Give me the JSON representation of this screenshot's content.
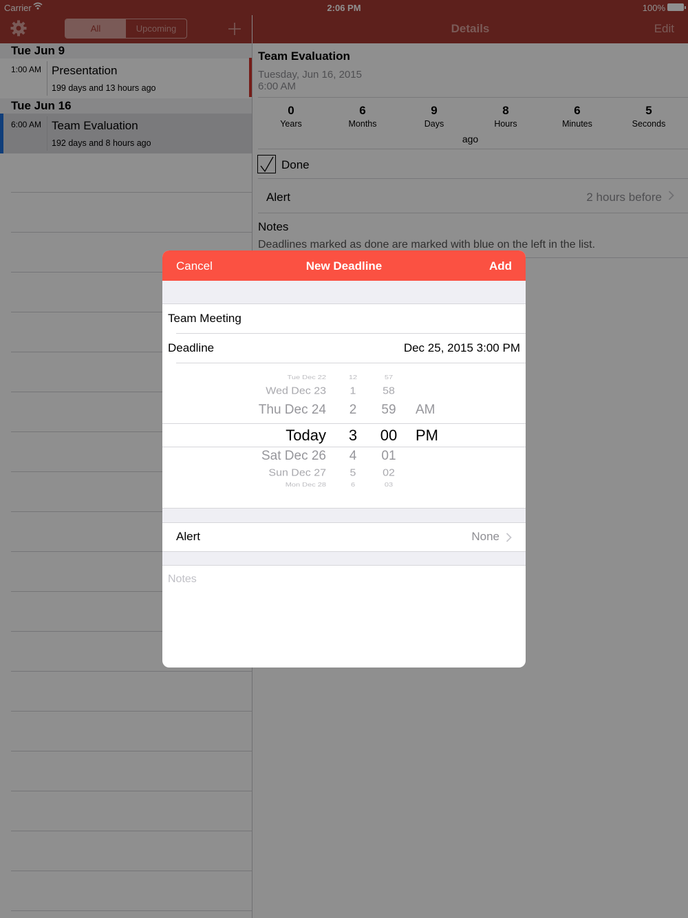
{
  "status_bar": {
    "carrier": "Carrier",
    "time": "2:06 PM",
    "battery": "100%"
  },
  "master_nav": {
    "segments": [
      "All",
      "Upcoming"
    ],
    "selected_segment": "All"
  },
  "detail_nav": {
    "title": "Details",
    "edit_label": "Edit"
  },
  "list": {
    "sections": [
      {
        "header": "Tue  Jun 9",
        "items": [
          {
            "time": "1:00 AM",
            "title": "Presentation",
            "relative": "199 days and 13 hours ago"
          }
        ]
      },
      {
        "header": "Tue  Jun 16",
        "items": [
          {
            "time": "6:00 AM",
            "title": "Team Evaluation",
            "relative": "192 days and 8 hours ago"
          }
        ]
      }
    ],
    "done_indicator_color": "#1e6fd9"
  },
  "details": {
    "title": "Team Evaluation",
    "date": "Tuesday, Jun 16, 2015",
    "time": "6:00 AM",
    "counters": [
      {
        "num": "0",
        "unit": "Years"
      },
      {
        "num": "6",
        "unit": "Months"
      },
      {
        "num": "9",
        "unit": "Days"
      },
      {
        "num": "8",
        "unit": "Hours"
      },
      {
        "num": "6",
        "unit": "Minutes"
      },
      {
        "num": "5",
        "unit": "Seconds"
      }
    ],
    "ago": "ago",
    "done_label": "Done",
    "done_checked": true,
    "alert_label": "Alert",
    "alert_value": "2 hours before",
    "notes_label": "Notes",
    "notes_text": "Deadlines marked as done are marked with blue on the left in the list."
  },
  "modal": {
    "cancel_label": "Cancel",
    "title": "New Deadline",
    "add_label": "Add",
    "name_value": "Team Meeting",
    "deadline_label": "Deadline",
    "deadline_value": "Dec 25, 2015  3:00 PM",
    "picker": {
      "rows": [
        {
          "date": "Tue Dec 22",
          "hour": "12",
          "minute": "57",
          "ampm": ""
        },
        {
          "date": "Wed Dec 23",
          "hour": "1",
          "minute": "58",
          "ampm": ""
        },
        {
          "date": "Thu Dec 24",
          "hour": "2",
          "minute": "59",
          "ampm": "AM"
        },
        {
          "date": "Today",
          "hour": "3",
          "minute": "00",
          "ampm": "PM"
        },
        {
          "date": "Sat Dec 26",
          "hour": "4",
          "minute": "01",
          "ampm": ""
        },
        {
          "date": "Sun Dec 27",
          "hour": "5",
          "minute": "02",
          "ampm": ""
        },
        {
          "date": "Mon Dec 28",
          "hour": "6",
          "minute": "03",
          "ampm": ""
        }
      ]
    },
    "alert_label": "Alert",
    "alert_value": "None",
    "notes_placeholder": "Notes"
  },
  "colors": {
    "nav_bar": "#a63a32",
    "modal_bar": "#fb5142",
    "deadline_marker": "#d0342c",
    "secondary_text": "#8e8e93"
  }
}
